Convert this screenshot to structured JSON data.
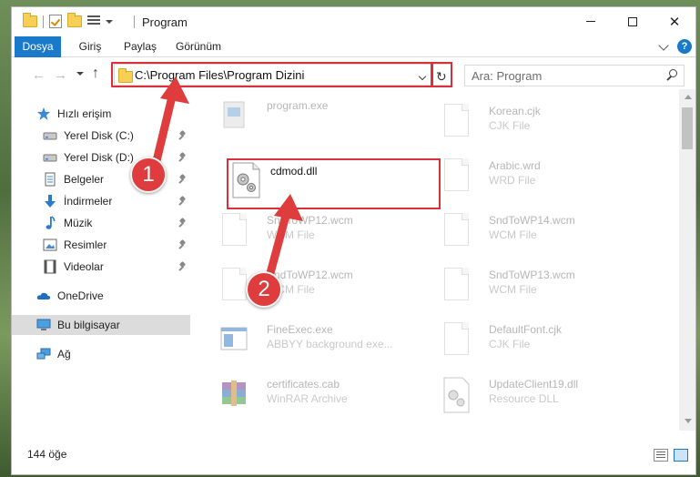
{
  "window": {
    "title": "Program"
  },
  "ribbon": {
    "tabs": [
      "Dosya",
      "Giriş",
      "Paylaş",
      "Görünüm"
    ],
    "help": "?"
  },
  "address": {
    "path": "C:\\Program Files\\Program Dizini",
    "search_placeholder": "Ara: Program"
  },
  "sidebar": {
    "items": [
      {
        "label": "Hızlı erişim",
        "icon": "star-icon"
      },
      {
        "label": "Yerel Disk (C:)",
        "icon": "drive-icon",
        "pinned": true
      },
      {
        "label": "Yerel Disk (D:)",
        "icon": "drive-icon",
        "pinned": true
      },
      {
        "label": "Belgeler",
        "icon": "documents-icon",
        "pinned": true
      },
      {
        "label": "İndirmeler",
        "icon": "download-icon",
        "pinned": true
      },
      {
        "label": "Müzik",
        "icon": "music-icon",
        "pinned": true
      },
      {
        "label": "Resimler",
        "icon": "pictures-icon",
        "pinned": true
      },
      {
        "label": "Videolar",
        "icon": "videos-icon",
        "pinned": true
      },
      {
        "label": "OneDrive",
        "icon": "cloud-icon"
      },
      {
        "label": "Bu bilgisayar",
        "icon": "computer-icon",
        "selected": true
      },
      {
        "label": "Ağ",
        "icon": "network-icon"
      }
    ]
  },
  "files": [
    {
      "name": "program.exe",
      "type": ""
    },
    {
      "name": "Korean.cjk",
      "type": "CJK File"
    },
    {
      "name": "cdmod.dll",
      "type": ""
    },
    {
      "name": "Arabic.wrd",
      "type": "WRD File"
    },
    {
      "name": "SndToWP12.wcm",
      "type": "WCM File"
    },
    {
      "name": "SndToWP14.wcm",
      "type": "WCM File"
    },
    {
      "name": "SndToWP12.wcm",
      "type": "WCM File"
    },
    {
      "name": "SndToWP13.wcm",
      "type": "WCM File"
    },
    {
      "name": "FineExec.exe",
      "type": "ABBYY background exe..."
    },
    {
      "name": "DefaultFont.cjk",
      "type": "CJK File"
    },
    {
      "name": "certificates.cab",
      "type": "WinRAR Archive"
    },
    {
      "name": "UpdateClient19.dll",
      "type": "Resource DLL"
    }
  ],
  "status": {
    "count": "144 öğe"
  },
  "callouts": [
    "1",
    "2"
  ],
  "colors": {
    "accent": "#1979ca",
    "highlight": "#d9303a",
    "callout": "#df3d3d"
  }
}
